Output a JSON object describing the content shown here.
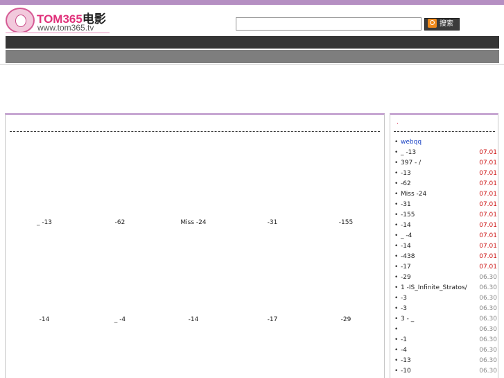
{
  "header": {
    "logo_title_latin": "TOM365",
    "logo_title_cn": "电影",
    "logo_url": "www.tom365.tv",
    "search_value": "",
    "search_button_label": "搜索"
  },
  "main": {
    "rows": [
      [
        "_ -13",
        "-62",
        "Miss -24",
        "-31",
        "-155"
      ],
      [
        "-14",
        "_ -4",
        "-14",
        "-17",
        "-29"
      ]
    ]
  },
  "sidebar": {
    "title": "·",
    "items": [
      {
        "label": "webqq",
        "date": "",
        "link": true
      },
      {
        "label": "_ -13",
        "date": "07.01"
      },
      {
        "label": "397 - /",
        "date": "07.01"
      },
      {
        "label": "-13",
        "date": "07.01"
      },
      {
        "label": "-62",
        "date": "07.01"
      },
      {
        "label": "Miss -24",
        "date": "07.01"
      },
      {
        "label": "-31",
        "date": "07.01"
      },
      {
        "label": "-155",
        "date": "07.01"
      },
      {
        "label": "-14",
        "date": "07.01"
      },
      {
        "label": "_ -4",
        "date": "07.01"
      },
      {
        "label": "-14",
        "date": "07.01"
      },
      {
        "label": "-438",
        "date": "07.01"
      },
      {
        "label": "-17",
        "date": "07.01"
      },
      {
        "label": "-29",
        "date": "06.30"
      },
      {
        "label": "1 -IS_Infinite_Stratos/",
        "date": "06.30"
      },
      {
        "label": "-3",
        "date": "06.30"
      },
      {
        "label": "-3",
        "date": "06.30"
      },
      {
        "label": "3 - _",
        "date": "06.30"
      },
      {
        "label": "",
        "date": "06.30"
      },
      {
        "label": "-1",
        "date": "06.30"
      },
      {
        "label": "-4",
        "date": "06.30"
      },
      {
        "label": "-13",
        "date": "06.30"
      },
      {
        "label": "-10",
        "date": "06.30"
      }
    ]
  },
  "colors": {
    "accent": "#b58fc2",
    "new_date": "#cc1111",
    "old_date": "#888888",
    "link": "#1a43c4"
  }
}
